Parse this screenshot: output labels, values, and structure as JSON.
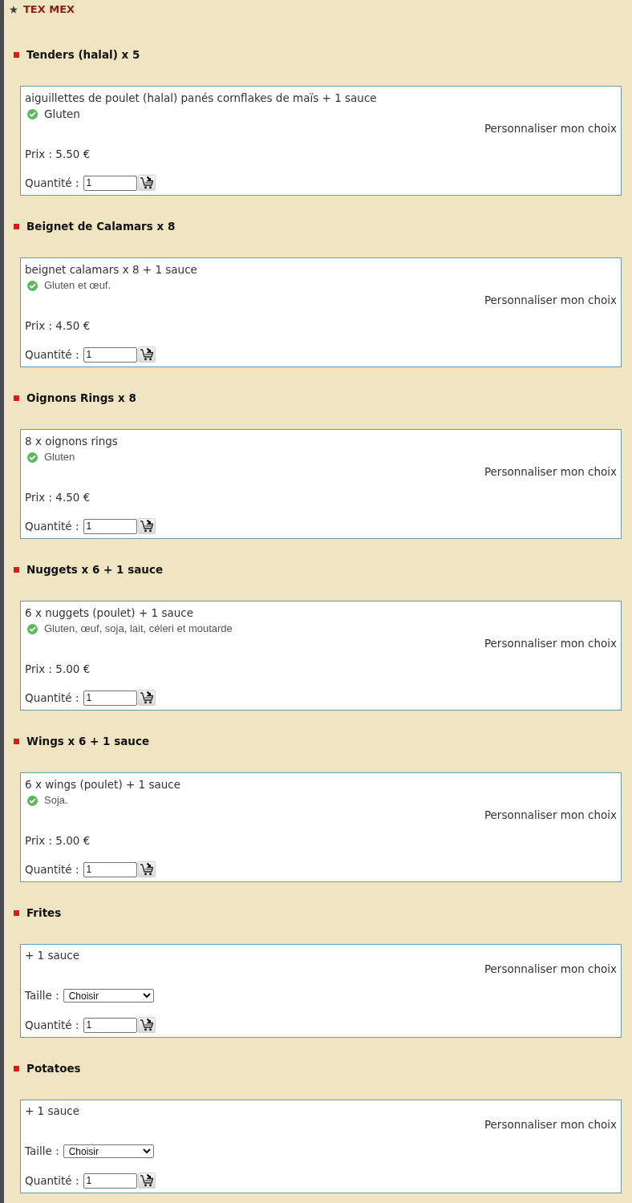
{
  "section": {
    "title": "TEX MEX"
  },
  "items": [
    {
      "title": "Tenders (halal) x 5",
      "description": "aiguillettes de poulet (halal) panés cornflakes de maïs + 1 sauce",
      "allergens": {
        "kind": "plain",
        "text": "Gluten"
      },
      "customize": "Personnaliser mon choix",
      "price": "Prix : 5.50 €",
      "quantity": {
        "label": "Quantité :",
        "value": "1"
      }
    },
    {
      "title": "Beignet de Calamars x 8",
      "description": "beignet calamars x 8 + 1 sauce",
      "allergens": {
        "kind": "note",
        "text": "Gluten et œuf."
      },
      "customize": "Personnaliser mon choix",
      "price": "Prix : 4.50 €",
      "quantity": {
        "label": "Quantité :",
        "value": "1"
      }
    },
    {
      "title": "Oignons Rings x 8",
      "description": "8 x oignons rings",
      "allergens": {
        "kind": "note",
        "text": "Gluten"
      },
      "customize": "Personnaliser mon choix",
      "price": "Prix : 4.50 €",
      "quantity": {
        "label": "Quantité :",
        "value": "1"
      }
    },
    {
      "title": "Nuggets x 6 + 1 sauce",
      "description": "6 x nuggets (poulet) + 1 sauce",
      "allergens": {
        "kind": "note",
        "text": "Gluten, œuf, soja, lait, céleri et moutarde"
      },
      "customize": "Personnaliser mon choix",
      "price": "Prix : 5.00 €",
      "quantity": {
        "label": "Quantité :",
        "value": "1"
      }
    },
    {
      "title": "Wings x 6 + 1 sauce",
      "description": "6 x wings (poulet) + 1 sauce",
      "allergens": {
        "kind": "note",
        "text": "Soja."
      },
      "customize": "Personnaliser mon choix",
      "price": "Prix : 5.00 €",
      "quantity": {
        "label": "Quantité :",
        "value": "1"
      }
    },
    {
      "title": "Frites",
      "description": "+ 1 sauce",
      "customize": "Personnaliser mon choix",
      "size": {
        "label": "Taille :",
        "value": "Choisir"
      },
      "quantity": {
        "label": "Quantité :",
        "value": "1"
      }
    },
    {
      "title": "Potatoes",
      "description": "+ 1 sauce",
      "customize": "Personnaliser mon choix",
      "size": {
        "label": "Taille :",
        "value": "Choisir"
      },
      "quantity": {
        "label": "Quantité :",
        "value": "1"
      }
    }
  ]
}
